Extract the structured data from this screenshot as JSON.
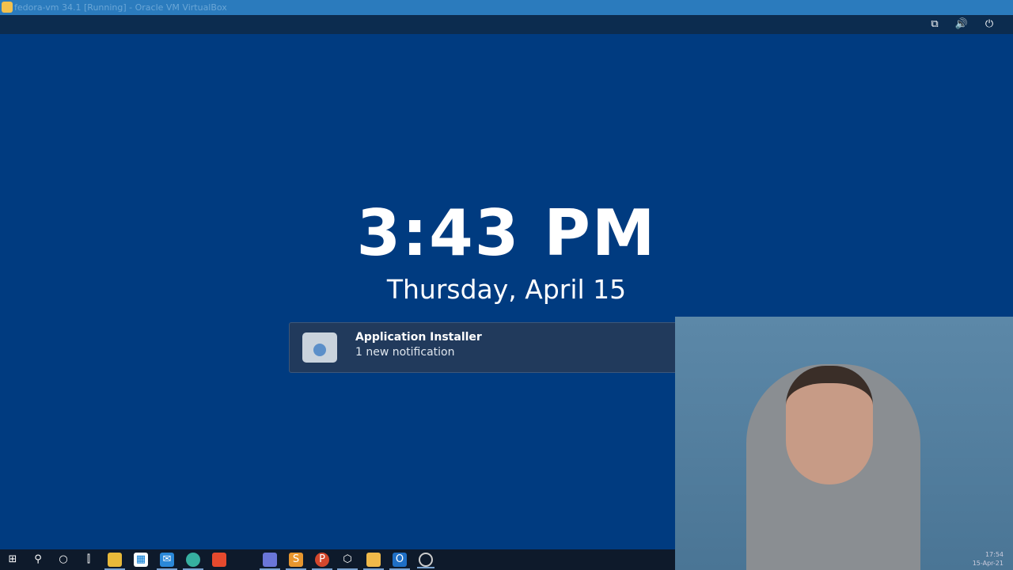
{
  "window": {
    "title": "fedora-vm 34.1 [Running] - Oracle VM VirtualBox"
  },
  "topbar": {
    "icons": [
      "network-icon",
      "volume-icon",
      "power-menu-icon"
    ]
  },
  "lockscreen": {
    "time": "3:43 PM",
    "date": "Thursday, April 15"
  },
  "notification": {
    "title": "Application Installer",
    "subtitle": "1 new notification",
    "icon": "software-bag-icon"
  },
  "taskbar": {
    "items": [
      "start",
      "search",
      "cortana",
      "task-view",
      "file-explorer",
      "store",
      "mail",
      "browser",
      "brave",
      "discord",
      "sublime-text",
      "powerpoint",
      "virtualbox-3d",
      "virtualbox",
      "outlook",
      "obs"
    ],
    "clock": {
      "time": "17:54",
      "date": "15-Apr-21"
    }
  }
}
